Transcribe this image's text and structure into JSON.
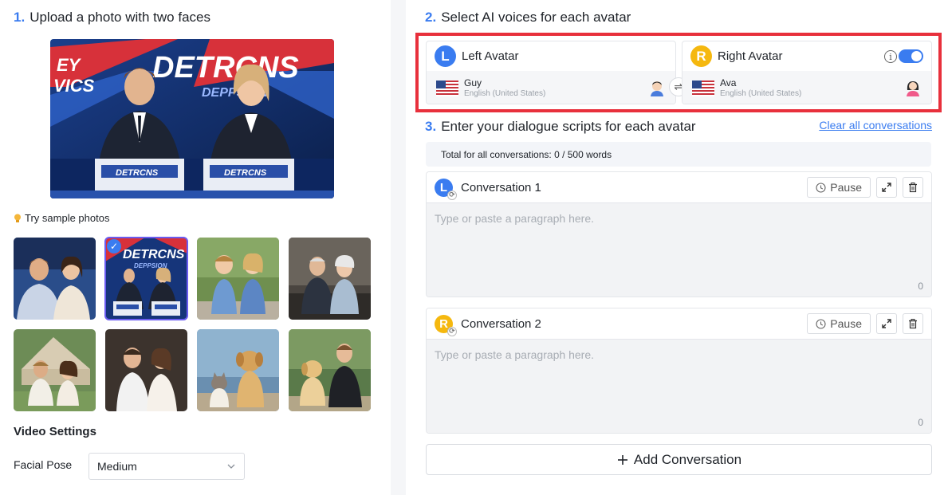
{
  "steps": {
    "step1_num": "1.",
    "step1_label": "Upload a photo with two faces",
    "step2_num": "2.",
    "step2_label": "Select AI voices for each avatar",
    "step3_num": "3.",
    "step3_label": "Enter your dialogue scripts for each avatar"
  },
  "sample_photos_label": "Try sample photos",
  "main_photo": {
    "banner_text_left": "EY",
    "banner_text_left2": "VICS",
    "banner_text_main": "DETRCNS",
    "banner_text_sub": "DEPPSION",
    "podium_text": "DETRCNS"
  },
  "video_settings": {
    "title": "Video Settings",
    "facial_pose_label": "Facial Pose",
    "facial_pose_value": "Medium"
  },
  "avatars": {
    "left": {
      "letter": "L",
      "title": "Left Avatar",
      "voice": "Guy",
      "language": "English (United States)"
    },
    "right": {
      "letter": "R",
      "title": "Right Avatar",
      "voice": "Ava",
      "language": "English (United States)"
    }
  },
  "swap_glyph": "⇌",
  "info_glyph": "i",
  "clear_all": "Clear all conversations",
  "total_words": "Total for all conversations: 0 / 500 words",
  "conversations": [
    {
      "letter": "L",
      "title": "Conversation 1",
      "pause": "Pause",
      "placeholder": "Type or paste a paragraph here.",
      "count": "0"
    },
    {
      "letter": "R",
      "title": "Conversation 2",
      "pause": "Pause",
      "placeholder": "Type or paste a paragraph here.",
      "count": "0"
    }
  ],
  "add_conversation": "Add Conversation",
  "colors": {
    "accent": "#3a7cf0",
    "right_avatar": "#f5b80f",
    "highlight": "#e8303c",
    "selected_outline": "#6a5cf0"
  }
}
